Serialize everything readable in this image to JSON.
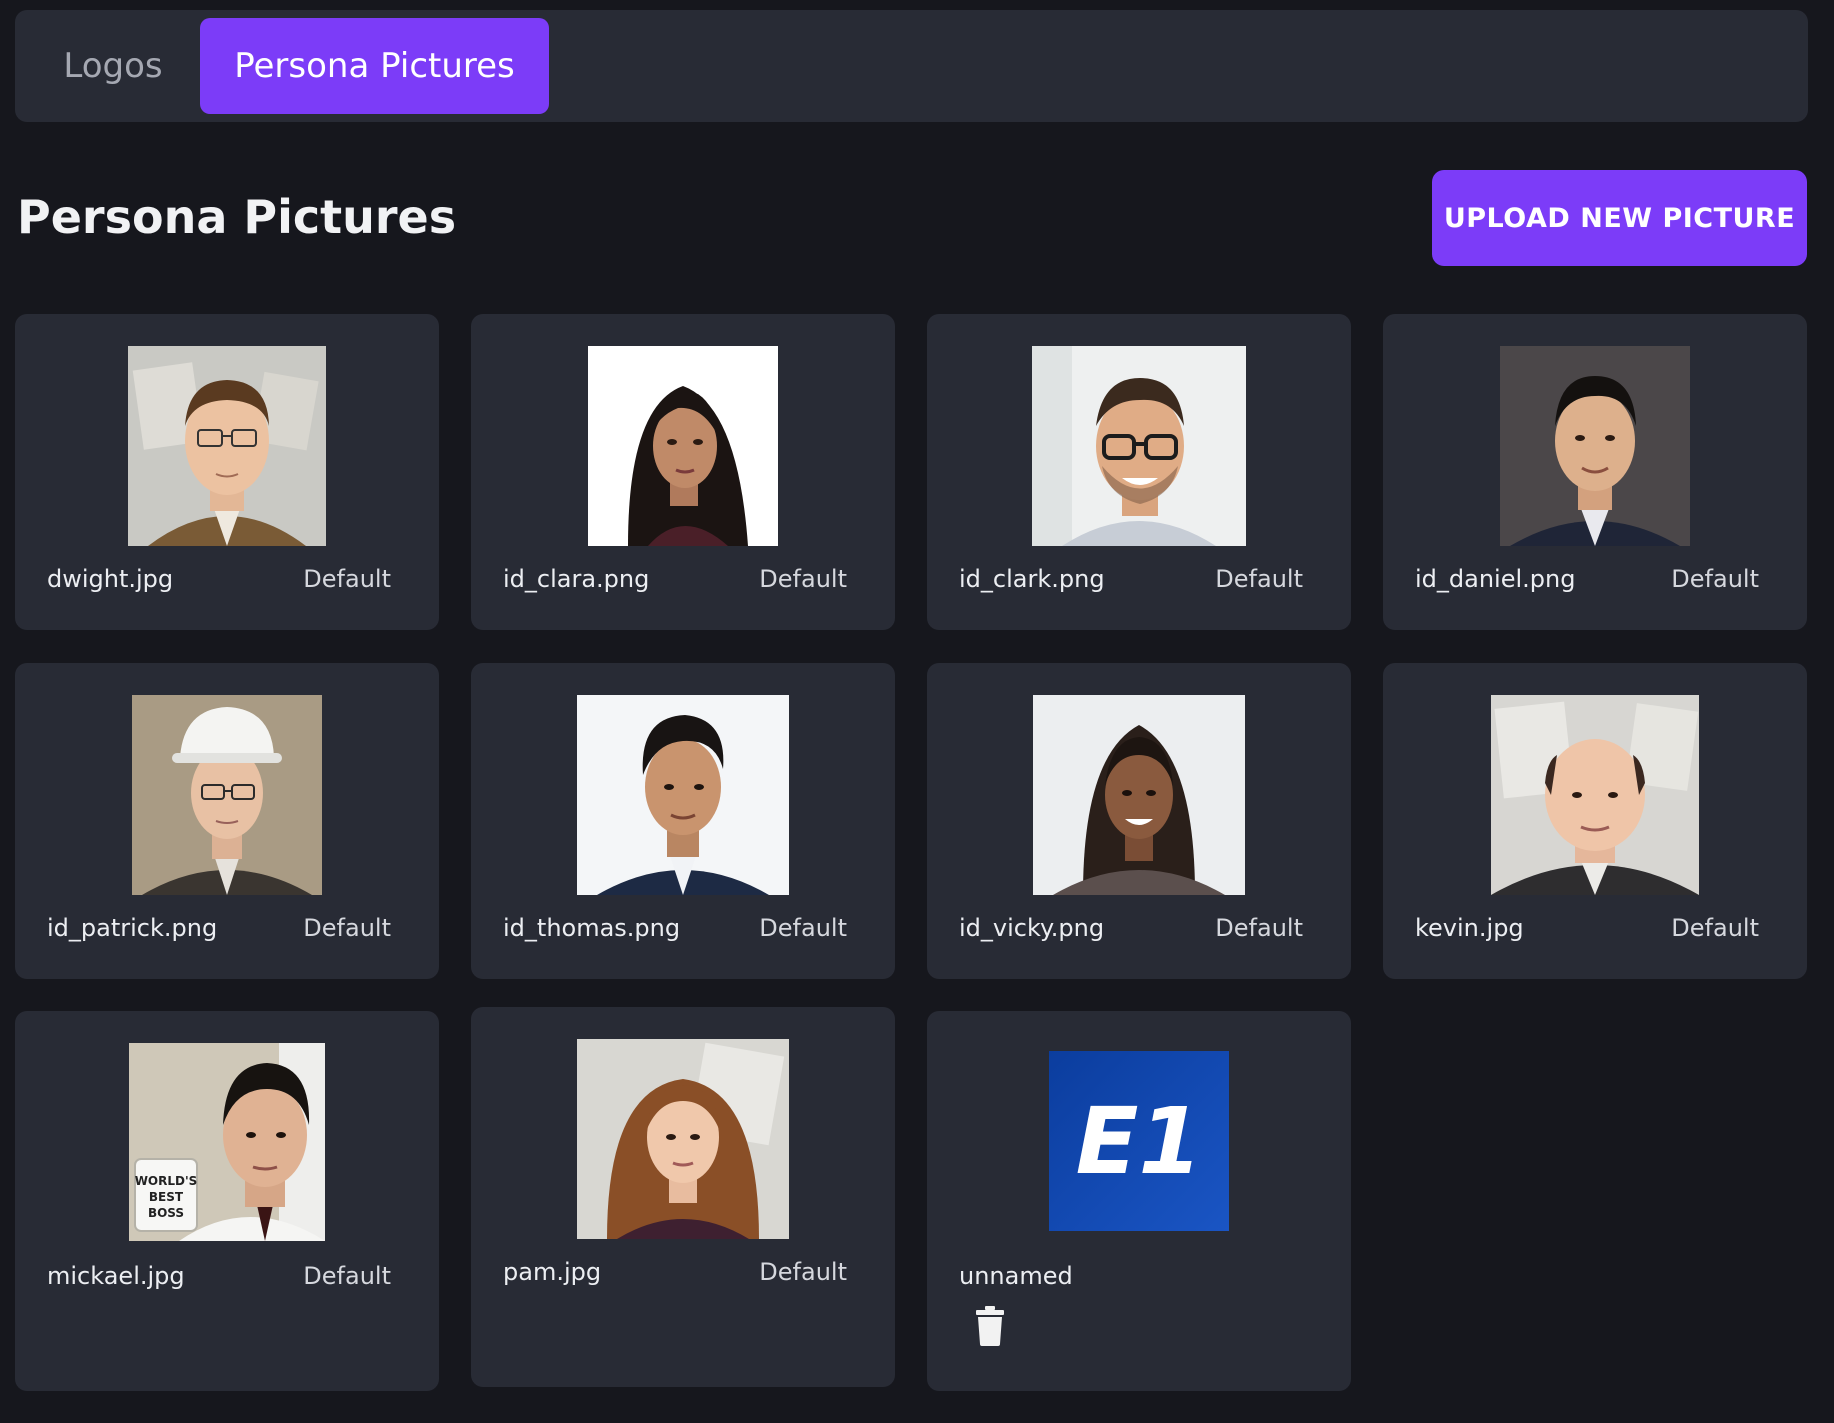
{
  "tabs": [
    {
      "label": "Logos",
      "active": false
    },
    {
      "label": "Persona Pictures",
      "active": true
    }
  ],
  "page": {
    "title": "Persona Pictures",
    "upload_label": "UPLOAD NEW PICTURE"
  },
  "colors": {
    "accent": "#7c3cf8",
    "background": "#16171d",
    "card": "#282b35"
  },
  "pictures": [
    {
      "filename": "dwight.jpg",
      "status": "Default"
    },
    {
      "filename": "id_clara.png",
      "status": "Default"
    },
    {
      "filename": "id_clark.png",
      "status": "Default"
    },
    {
      "filename": "id_daniel.png",
      "status": "Default"
    },
    {
      "filename": "id_patrick.png",
      "status": "Default"
    },
    {
      "filename": "id_thomas.png",
      "status": "Default"
    },
    {
      "filename": "id_vicky.png",
      "status": "Default"
    },
    {
      "filename": "kevin.jpg",
      "status": "Default"
    },
    {
      "filename": "mickael.jpg",
      "status": "Default",
      "mug_text": [
        "WORLD'S",
        "BEST",
        "BOSS"
      ]
    },
    {
      "filename": "pam.jpg",
      "status": "Default"
    },
    {
      "filename": "unnamed",
      "status": "",
      "logo_text": "E1",
      "action_icon": "trash-icon"
    }
  ]
}
